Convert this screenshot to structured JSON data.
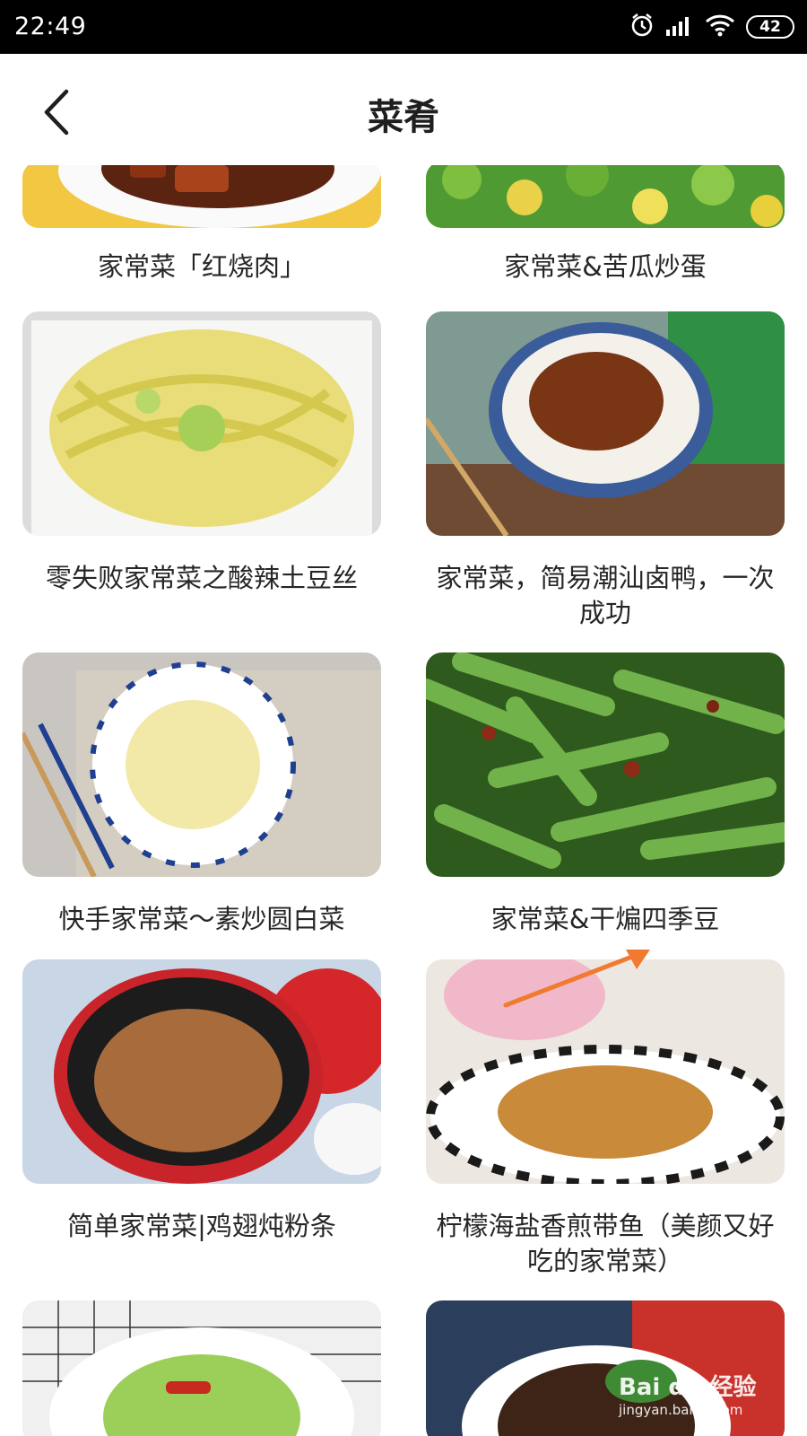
{
  "status_bar": {
    "time": "22:49",
    "battery": "42",
    "icons": [
      "alarm-icon",
      "signal-icon",
      "wifi-icon",
      "battery-icon"
    ]
  },
  "header": {
    "title": "菜肴",
    "back_icon": "chevron-left-icon"
  },
  "cards": [
    {
      "caption": "家常菜「红烧肉」"
    },
    {
      "caption": "家常菜&苦瓜炒蛋"
    },
    {
      "caption": "零失败家常菜之酸辣土豆丝"
    },
    {
      "caption": "家常菜，简易潮汕卤鸭，一次成功"
    },
    {
      "caption": "快手家常菜～素炒圆白菜"
    },
    {
      "caption": "家常菜&干煸四季豆"
    },
    {
      "caption": "简单家常菜|鸡翅炖粉条"
    },
    {
      "caption": "柠檬海盐香煎带鱼（美颜又好吃的家常菜）"
    },
    {
      "caption": ""
    },
    {
      "caption": ""
    }
  ],
  "watermark": {
    "brand": "Bai du 经验",
    "url": "jingyan.baidu.com"
  },
  "colors": {
    "accent_arrow": "#f07a2f",
    "status_bar": "#000000",
    "title": "#1f1f1f"
  }
}
